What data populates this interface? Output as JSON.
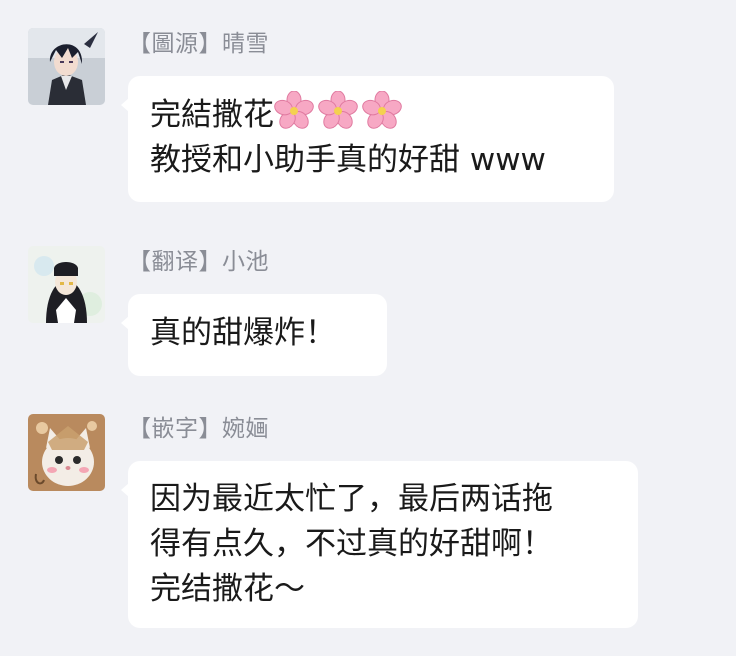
{
  "messages": [
    {
      "avatar_icon": "anime-boy-avatar",
      "sender": "【圖源】晴雪",
      "lines": [
        "完結撒花",
        "教授和小助手真的好甜 www"
      ],
      "emoji": "cherry-blossom-icon"
    },
    {
      "avatar_icon": "anime-girl-avatar",
      "sender": "【翻译】小池",
      "lines": [
        "真的甜爆炸！"
      ]
    },
    {
      "avatar_icon": "cat-avatar",
      "sender": "【嵌字】婉婳",
      "lines": [
        "因为最近太忙了，最后两话拖",
        "得有点久，不过真的好甜啊！",
        "完结撒花～"
      ]
    }
  ],
  "colors": {
    "background": "#f1f2f6",
    "bubble": "#ffffff",
    "sender_text": "#8a8d96",
    "message_text": "#1a1a1a",
    "blossom": "#f7a8c4"
  }
}
